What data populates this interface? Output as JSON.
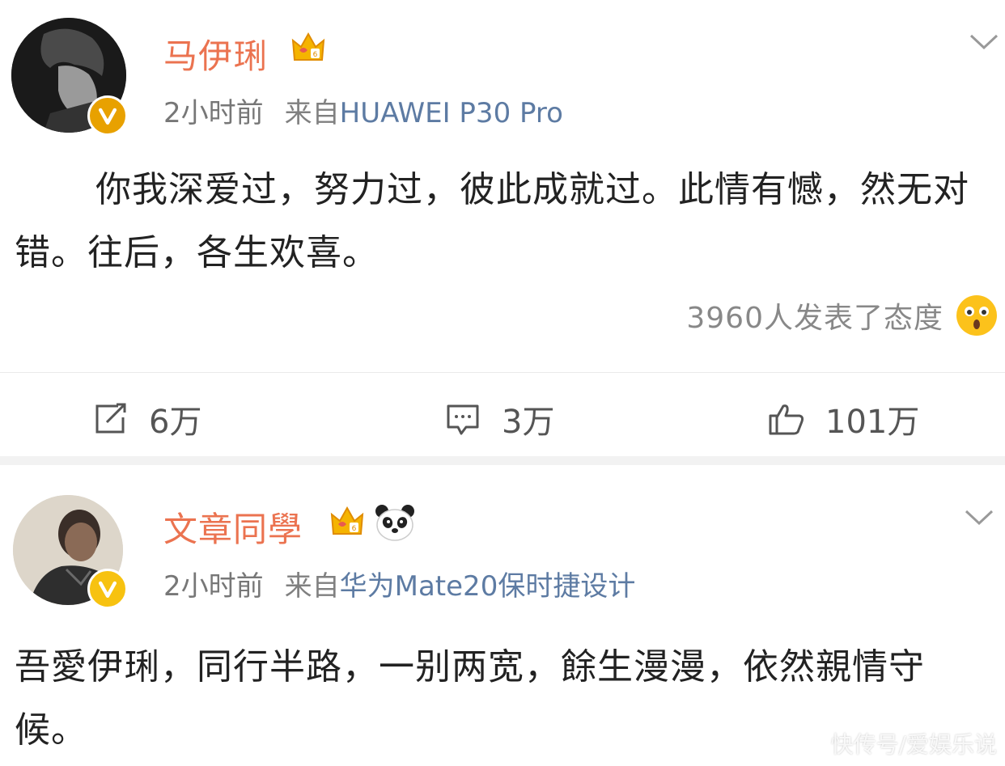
{
  "posts": [
    {
      "username": "马伊琍",
      "time": "2小时前",
      "source_prefix": "来自",
      "device": "HUAWEI P30 Pro",
      "content": "你我深爱过，努力过，彼此成就过。此情有憾，然无对错。往后，各生欢喜。",
      "reactions_text": "3960人发表了态度",
      "reaction_icon": "surprised-emoji-icon",
      "actions": {
        "repost": "6万",
        "comment": "3万",
        "like": "101万"
      },
      "colors": {
        "username": "#eb7350",
        "device": "#5d7ba3",
        "verified_badge": "#e8a100"
      }
    },
    {
      "username": "文章同學",
      "time": "2小时前",
      "source_prefix": "来自",
      "device": "华为Mate20保时捷设计",
      "content": "吾愛伊琍，同行半路，一别两宽，餘生漫漫，依然親情守候。",
      "colors": {
        "username": "#eb7350",
        "device": "#5d7ba3",
        "verified_badge": "#f7c210"
      }
    }
  ],
  "watermark": "快传号/爱娱乐说"
}
